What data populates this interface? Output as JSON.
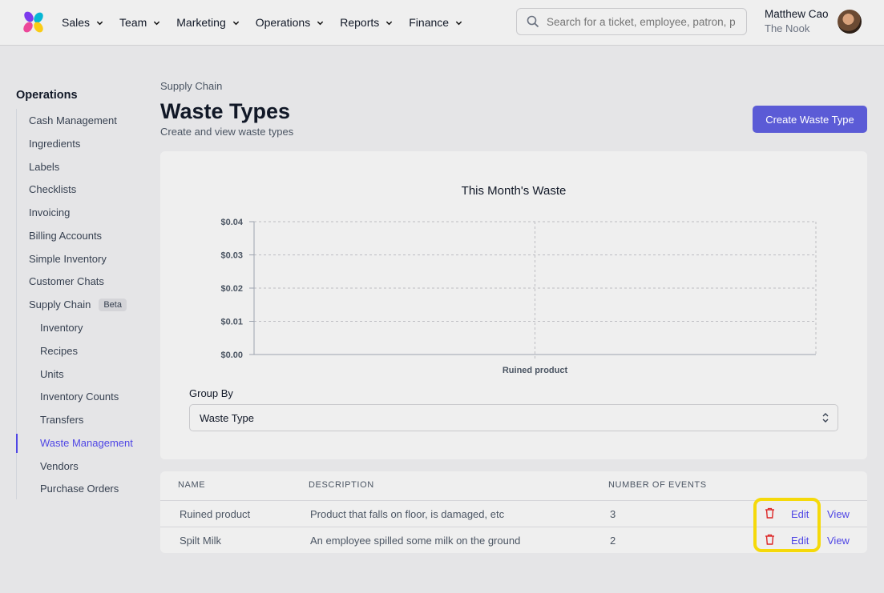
{
  "nav": {
    "items": [
      {
        "label": "Sales"
      },
      {
        "label": "Team"
      },
      {
        "label": "Marketing"
      },
      {
        "label": "Operations"
      },
      {
        "label": "Reports"
      },
      {
        "label": "Finance"
      }
    ],
    "search_placeholder": "Search for a ticket, employee, patron, p",
    "user": {
      "name": "Matthew Cao",
      "org": "The Nook"
    }
  },
  "sidebar": {
    "title": "Operations",
    "items": [
      {
        "label": "Cash Management"
      },
      {
        "label": "Ingredients"
      },
      {
        "label": "Labels"
      },
      {
        "label": "Checklists"
      },
      {
        "label": "Invoicing"
      },
      {
        "label": "Billing Accounts"
      },
      {
        "label": "Simple Inventory"
      },
      {
        "label": "Customer Chats"
      },
      {
        "label": "Supply Chain",
        "badge": "Beta"
      },
      {
        "label": "Inventory"
      },
      {
        "label": "Recipes"
      },
      {
        "label": "Units"
      },
      {
        "label": "Inventory Counts"
      },
      {
        "label": "Transfers"
      },
      {
        "label": "Waste Management"
      },
      {
        "label": "Vendors"
      },
      {
        "label": "Purchase Orders"
      }
    ],
    "active": "Waste Management"
  },
  "header": {
    "breadcrumb": "Supply Chain",
    "title": "Waste Types",
    "subtitle": "Create and view waste types",
    "create_button": "Create Waste Type"
  },
  "chart_data": {
    "type": "bar",
    "title": "This Month's Waste",
    "categories": [
      "Ruined product"
    ],
    "values": [
      0
    ],
    "yticks": [
      "$0.00",
      "$0.01",
      "$0.02",
      "$0.03",
      "$0.04"
    ],
    "ylim": [
      0,
      0.04
    ],
    "grid": true
  },
  "groupby": {
    "label": "Group By",
    "value": "Waste Type"
  },
  "table": {
    "headers": {
      "name": "NAME",
      "description": "DESCRIPTION",
      "events": "NUMBER OF EVENTS"
    },
    "rows": [
      {
        "name": "Ruined product",
        "description": "Product that falls on floor, is damaged, etc",
        "events": "3",
        "edit": "Edit",
        "view": "View"
      },
      {
        "name": "Spilt Milk",
        "description": "An employee spilled some milk on the ground",
        "events": "2",
        "edit": "Edit",
        "view": "View"
      }
    ]
  },
  "colors": {
    "accent": "#5b5bd6",
    "link": "#4f46e5",
    "danger": "#dc2626",
    "highlight": "#f5d90a"
  }
}
